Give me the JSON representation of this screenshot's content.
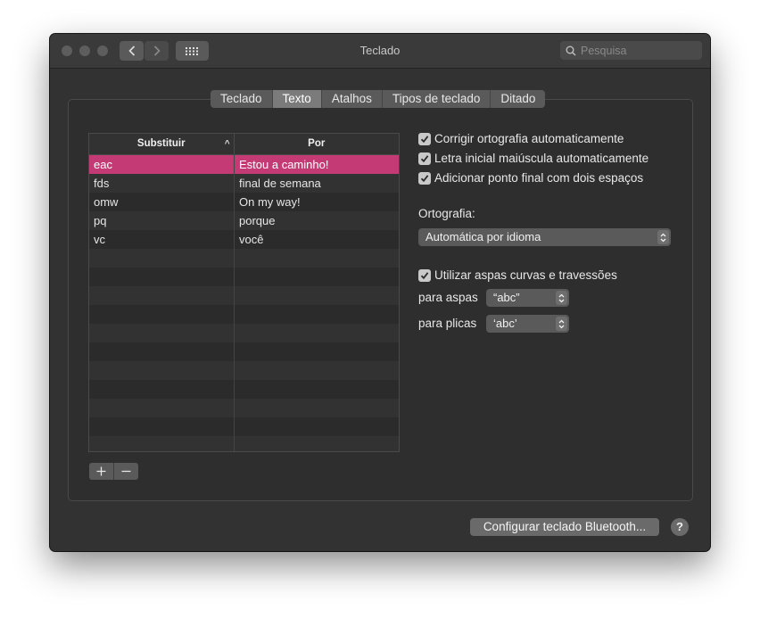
{
  "window": {
    "title": "Teclado"
  },
  "search": {
    "placeholder": "Pesquisa"
  },
  "tabs": [
    {
      "label": "Teclado"
    },
    {
      "label": "Texto",
      "active": true
    },
    {
      "label": "Atalhos"
    },
    {
      "label": "Tipos de teclado"
    },
    {
      "label": "Ditado"
    }
  ],
  "table": {
    "headers": {
      "replace": "Substituir",
      "with": "Por"
    },
    "rows": [
      {
        "replace": "eac",
        "with": "Estou a caminho!",
        "selected": true
      },
      {
        "replace": "fds",
        "with": "final de semana"
      },
      {
        "replace": "omw",
        "with": "On my way!"
      },
      {
        "replace": "pq",
        "with": "porque"
      },
      {
        "replace": "vc",
        "with": "você"
      }
    ]
  },
  "options": {
    "correct_spelling": "Corrigir ortografia automaticamente",
    "capitalize": "Letra inicial maiúscula automaticamente",
    "period_double_space": "Adicionar ponto final com dois espaços",
    "spelling_label": "Ortografia:",
    "spelling_value": "Automática por idioma",
    "smart_quotes": "Utilizar aspas curvas e travessões",
    "double_quotes_label": "para aspas",
    "double_quotes_value": "“abc”",
    "single_quotes_label": "para plicas",
    "single_quotes_value": "‘abc’"
  },
  "footer": {
    "bluetooth_button": "Configurar teclado Bluetooth...",
    "help": "?"
  },
  "colors": {
    "selection": "#c43a75",
    "window_bg": "#323232"
  }
}
